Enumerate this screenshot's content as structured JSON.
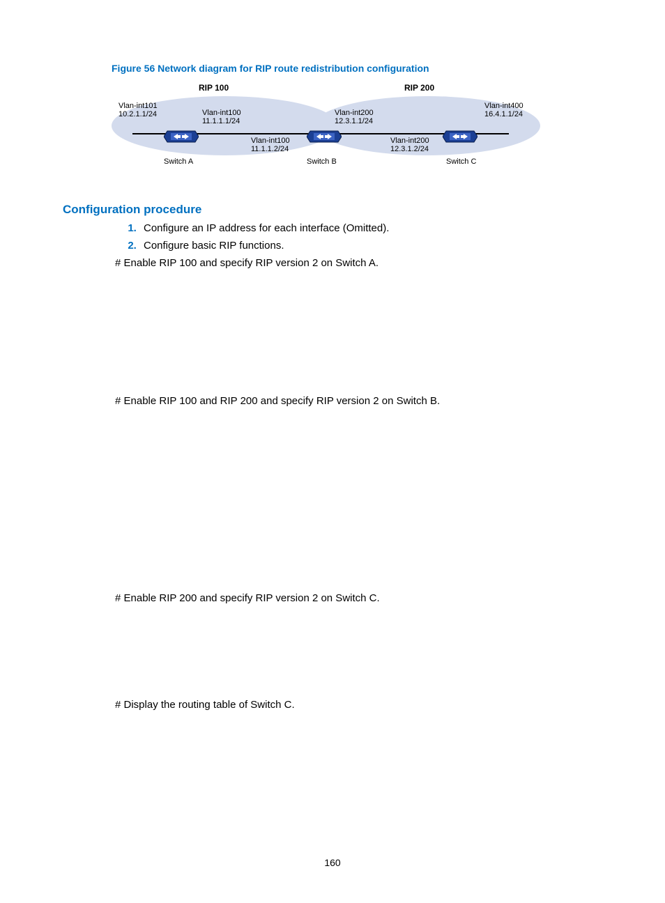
{
  "figure": {
    "caption": "Figure 56 Network diagram for RIP route redistribution configuration",
    "rip100_label": "RIP 100",
    "rip200_label": "RIP 200",
    "switchA": "Switch A",
    "switchB": "Switch B",
    "switchC": "Switch C",
    "vlan101": "Vlan-int101\n10.2.1.1/24",
    "vlan100a": "Vlan-int100\n11.1.1.1/24",
    "vlan100b": "Vlan-int100\n11.1.1.2/24",
    "vlan200a": "Vlan-int200\n12.3.1.1/24",
    "vlan200b": "Vlan-int200\n12.3.1.2/24",
    "vlan400": "Vlan-int400\n16.4.1.1/24"
  },
  "section_heading": "Configuration procedure",
  "steps": [
    "Configure an IP address for each interface (Omitted).",
    "Configure basic RIP functions."
  ],
  "instr_a": "# Enable RIP 100 and specify RIP version 2 on Switch A.",
  "instr_b": "# Enable RIP 100 and RIP 200 and specify RIP version 2 on Switch B.",
  "instr_c": "# Enable RIP 200 and specify RIP version 2 on Switch C.",
  "instr_d": "# Display the routing table of Switch C.",
  "page_number": "160"
}
